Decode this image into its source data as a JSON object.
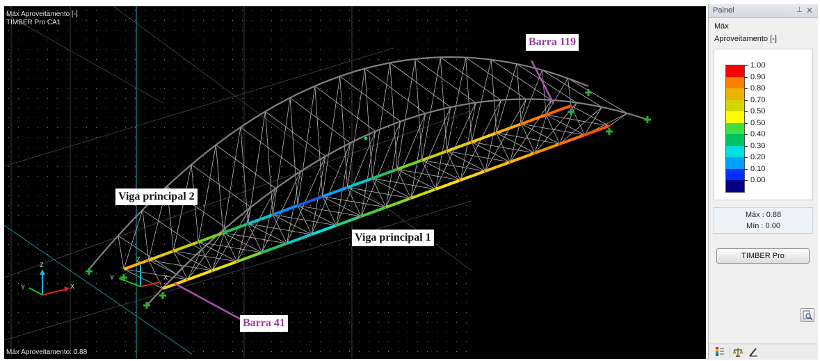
{
  "viewport": {
    "title": "Máx Aproveitamento [-]",
    "subtitle": "TIMBER Pro CA1",
    "status": "Máx Aproveitamento: 0.88",
    "axes": {
      "x": "X",
      "y": "Y",
      "z": "Z"
    }
  },
  "callouts": {
    "barra_119": "Barra 119",
    "barra_41": "Barra 41",
    "viga_2": "Viga principal 2",
    "viga_1": "Viga principal 1"
  },
  "panel": {
    "title": "Painel",
    "pin_glyph": "⊥",
    "close_glyph": "✕",
    "result_line1": "Máx",
    "result_line2": "Aproveitamento [-]",
    "legend": [
      {
        "value": "1.00",
        "color": "#ff0000"
      },
      {
        "value": "0.90",
        "color": "#ff8000"
      },
      {
        "value": "0.80",
        "color": "#e8b400"
      },
      {
        "value": "0.70",
        "color": "#d4d400"
      },
      {
        "value": "0.50",
        "color": "#ffff00"
      },
      {
        "value": "0.50",
        "color": "#40e040"
      },
      {
        "value": "0.40",
        "color": "#00c060"
      },
      {
        "value": "0.30",
        "color": "#00e0e0"
      },
      {
        "value": "0.20",
        "color": "#00a0ff"
      },
      {
        "value": "0.10",
        "color": "#0030ff"
      },
      {
        "value": "0.00",
        "color": "#000080"
      }
    ],
    "max_label": "Máx :  0.88",
    "min_label": "Mín  :  0.00",
    "button_label": "TIMBER Pro"
  }
}
